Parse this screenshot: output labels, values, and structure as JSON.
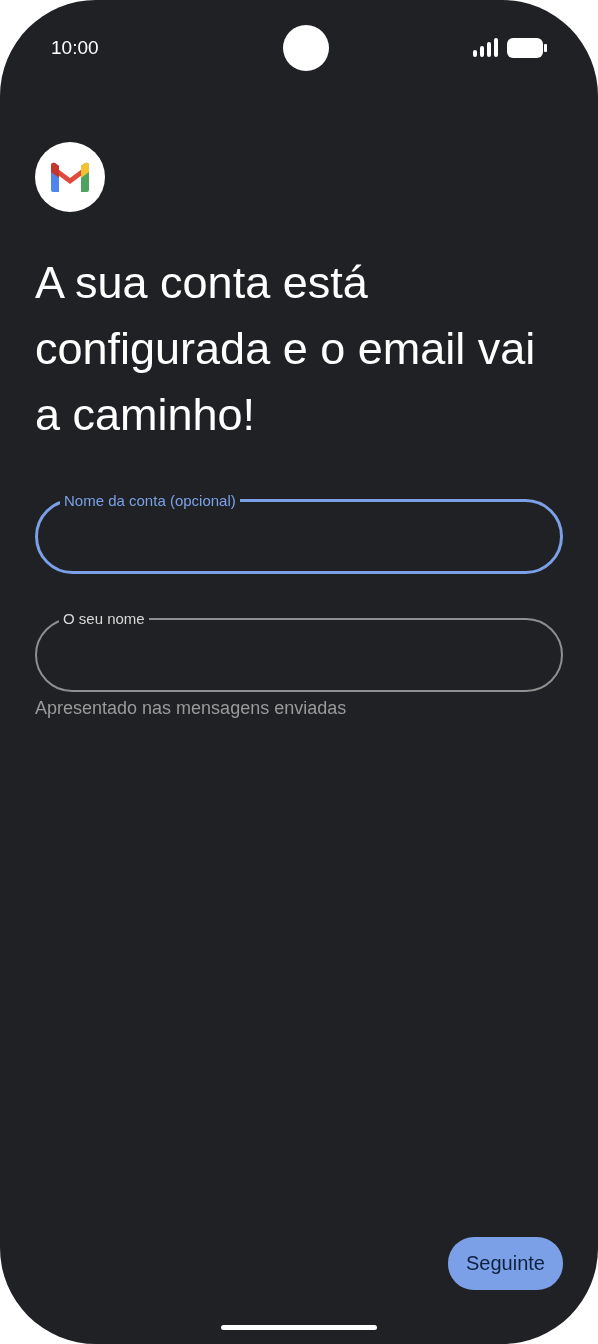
{
  "status_bar": {
    "time": "10:00"
  },
  "title": "A sua conta está configurada e o email vai a caminho!",
  "fields": [
    {
      "label": "Nome da conta (opcional)",
      "focused": true
    },
    {
      "label": "O seu nome",
      "focused": false,
      "helper": "Apresentado nas mensagens enviadas"
    }
  ],
  "next_button": "Seguinte"
}
